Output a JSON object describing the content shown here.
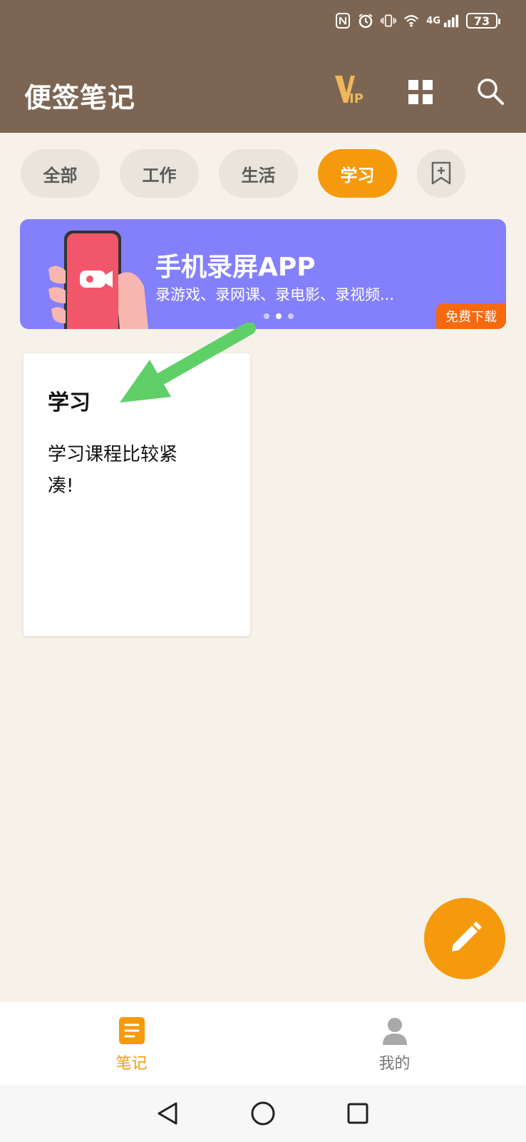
{
  "status": {
    "network": "4G",
    "battery": "73"
  },
  "header": {
    "title": "便签笔记"
  },
  "tabs": [
    {
      "label": "全部",
      "active": false
    },
    {
      "label": "工作",
      "active": false
    },
    {
      "label": "生活",
      "active": false
    },
    {
      "label": "学习",
      "active": true
    }
  ],
  "banner": {
    "title": "手机录屏APP",
    "subtitle": "录游戏、录网课、录电影、录视频...",
    "cta": "免费下载"
  },
  "note": {
    "title": "学习",
    "body": "学习课程比较紧凑!"
  },
  "bottom_nav": [
    {
      "label": "笔记",
      "icon": "note-icon",
      "active": true
    },
    {
      "label": "我的",
      "icon": "profile-icon",
      "active": false
    }
  ],
  "colors": {
    "header_bg": "#7c6653",
    "accent": "#f59a0c",
    "banner_bg": "#8480fc",
    "page_bg": "#f6f2e9"
  }
}
